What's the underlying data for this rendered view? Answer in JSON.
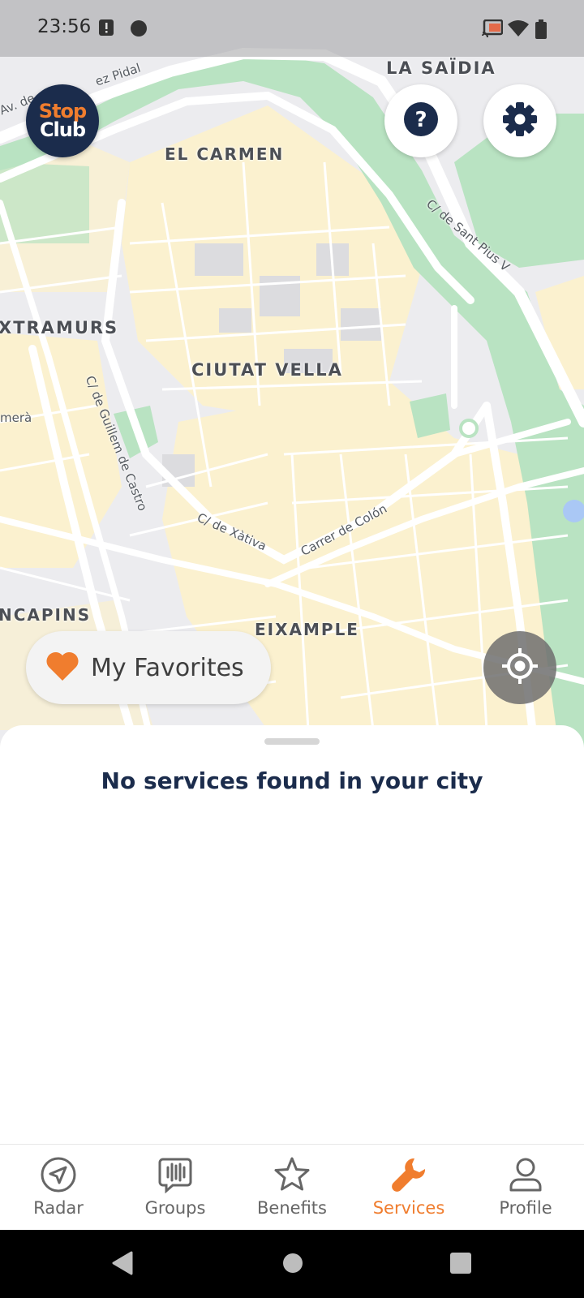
{
  "status_bar": {
    "time": "23:56",
    "icons": [
      "alert-icon",
      "circle-app-icon",
      "cast-icon",
      "wifi-icon",
      "battery-icon"
    ]
  },
  "map": {
    "districts": [
      {
        "name": "LA SAÏDIA"
      },
      {
        "name": "EL CARMEN"
      },
      {
        "name": "XTRAMURS"
      },
      {
        "name": "CIUTAT VELLA"
      },
      {
        "name": "NCAPINS"
      },
      {
        "name": "EIXAMPLE"
      }
    ],
    "streets": [
      {
        "name": "Av. de"
      },
      {
        "name": "ez Pidal"
      },
      {
        "name": "C/ de Sant Pius V"
      },
      {
        "name": "C/ de Guillem de Castro"
      },
      {
        "name": "C/ de Xàtiva"
      },
      {
        "name": "Carrer de Colón"
      },
      {
        "name": "merà"
      }
    ]
  },
  "header": {
    "logo_line1": "Stop",
    "logo_line2": "Club",
    "help_icon": "question-icon",
    "settings_icon": "gear-icon"
  },
  "favorites": {
    "label": "My Favorites",
    "icon": "heart-icon"
  },
  "locate": {
    "icon": "crosshair-icon"
  },
  "sheet": {
    "message": "No services found in your city"
  },
  "bottom_nav": {
    "items": [
      {
        "label": "Radar",
        "icon": "navigation-icon",
        "active": false
      },
      {
        "label": "Groups",
        "icon": "groups-icon",
        "active": false
      },
      {
        "label": "Benefits",
        "icon": "star-icon",
        "active": false
      },
      {
        "label": "Services",
        "icon": "wrench-icon",
        "active": true
      },
      {
        "label": "Profile",
        "icon": "person-icon",
        "active": false
      }
    ]
  },
  "colors": {
    "brand_navy": "#1b2c4c",
    "accent_orange": "#f07d2e",
    "park_green": "#b9e3c2",
    "urban_yellow": "#fdf5d6"
  }
}
